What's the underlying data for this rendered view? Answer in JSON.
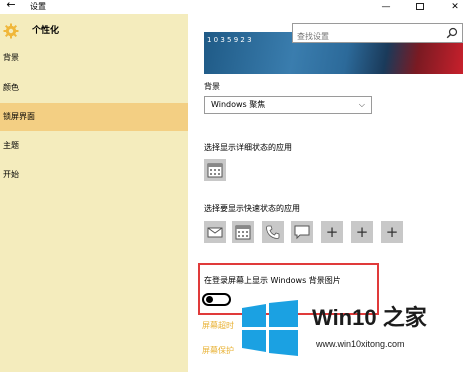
{
  "window": {
    "back_glyph": "←",
    "title": "设置",
    "minimize_glyph": "—",
    "close_glyph": "✕"
  },
  "sidebar": {
    "header_title": "个性化",
    "items": [
      {
        "label": "背景"
      },
      {
        "label": "颜色"
      },
      {
        "label": "锁屏界面"
      },
      {
        "label": "主题"
      },
      {
        "label": "开始"
      }
    ],
    "selected_index": 2
  },
  "search": {
    "placeholder": "查找设置"
  },
  "preview": {
    "text": "1 0 3 5 9 2 3"
  },
  "background_section": {
    "label": "背景",
    "selected_value": "Windows 聚焦"
  },
  "detailed_status": {
    "label": "选择显示详细状态的应用"
  },
  "quick_status": {
    "label": "选择要显示快速状态的应用",
    "apps": [
      "mail-icon",
      "calendar-icon",
      "phone-icon",
      "message-icon",
      "add-icon",
      "add-icon",
      "add-icon"
    ],
    "plus_glyph": "+"
  },
  "signin_background": {
    "label": "在登录屏幕上显示 Windows 背景图片",
    "state": "off"
  },
  "links": {
    "screen_timeout": "屏幕超时",
    "screen_saver": "屏幕保护"
  },
  "watermark": {
    "brand": "Win10 之家",
    "url": "www.win10xitong.com"
  },
  "colors": {
    "sidebar_bg": "#f4ecbd",
    "sidebar_selected": "#f3cf83",
    "highlight_border": "#e03a3a",
    "link": "#e8b030"
  }
}
